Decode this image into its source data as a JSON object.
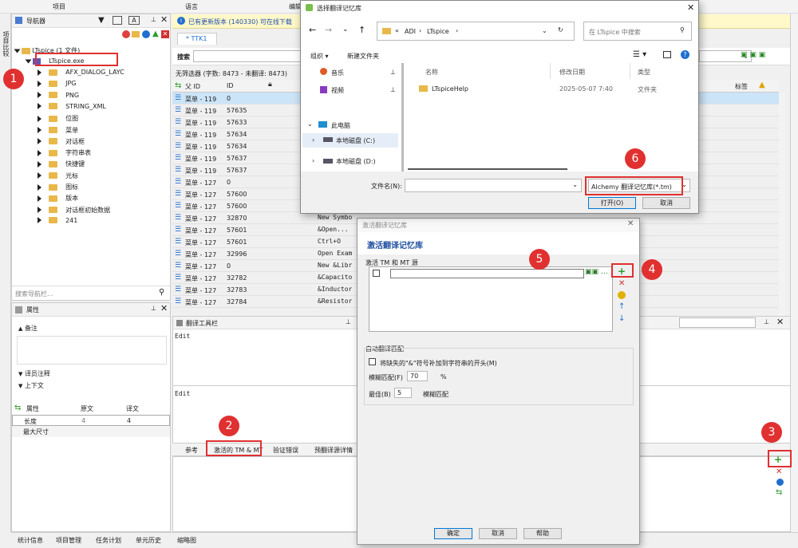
{
  "topbar": {
    "project": "项目",
    "lang": "语言",
    "edit": "编辑"
  },
  "left_vtab": "项目比较",
  "navigator": {
    "title": "导航器",
    "root": "LTspice (1 文件)",
    "file": "LTspice.exe",
    "items": [
      "AFX_DIALOG_LAYC",
      "JPG",
      "PNG",
      "STRING_XML",
      "位图",
      "菜单",
      "对话框",
      "字符串表",
      "快捷键",
      "光标",
      "图标",
      "版本",
      "对话框初始数据",
      "241"
    ],
    "search_placeholder": "搜索导航栏..."
  },
  "properties": {
    "title": "属性",
    "remarks": "备注",
    "translator_notes": "译员注释",
    "context": "上下文",
    "header": {
      "prop": "属性",
      "source": "原文",
      "target": "译文"
    },
    "rows": [
      {
        "name": "长度",
        "source": "4",
        "target": "4"
      },
      {
        "name": "最大尺寸",
        "source": "",
        "target": ""
      }
    ]
  },
  "infobar": {
    "text": "已有更新版本 (140330) 可在线下载"
  },
  "tab": {
    "label": "* TTK1"
  },
  "searchbar": {
    "label": "搜索"
  },
  "filter": {
    "text": "无筛选器 (字数: 8473 - 未翻译: 8473)"
  },
  "grid": {
    "headers": {
      "parent_id": "父 ID",
      "id": "ID",
      "tag": "标签"
    },
    "rows": [
      {
        "parent": "菜单 - 119",
        "id": "0",
        "text": ""
      },
      {
        "parent": "菜单 - 119",
        "id": "57635",
        "text": ""
      },
      {
        "parent": "菜单 - 119",
        "id": "57633",
        "text": ""
      },
      {
        "parent": "菜单 - 119",
        "id": "57634",
        "text": ""
      },
      {
        "parent": "菜单 - 119",
        "id": "57634",
        "text": ""
      },
      {
        "parent": "菜单 - 119",
        "id": "57637",
        "text": ""
      },
      {
        "parent": "菜单 - 119",
        "id": "57637",
        "text": ""
      },
      {
        "parent": "菜单 - 127",
        "id": "0",
        "text": ""
      },
      {
        "parent": "菜单 - 127",
        "id": "57600",
        "text": ""
      },
      {
        "parent": "菜单 - 127",
        "id": "57600",
        "text": ""
      },
      {
        "parent": "菜单 - 127",
        "id": "32870",
        "text": "New Symbo"
      },
      {
        "parent": "菜单 - 127",
        "id": "57601",
        "text": "&Open..."
      },
      {
        "parent": "菜单 - 127",
        "id": "57601",
        "text": "Ctrl+O"
      },
      {
        "parent": "菜单 - 127",
        "id": "32996",
        "text": "Open Exam"
      },
      {
        "parent": "菜单 - 127",
        "id": "0",
        "text": "New &Libr"
      },
      {
        "parent": "菜单 - 127",
        "id": "32782",
        "text": "&Capacito"
      },
      {
        "parent": "菜单 - 127",
        "id": "32783",
        "text": "&Inductor"
      },
      {
        "parent": "菜单 - 127",
        "id": "32784",
        "text": "&Resistor"
      }
    ]
  },
  "translation_toolbar": {
    "title": "翻译工具栏",
    "source": "Edit",
    "target": "Edit"
  },
  "bottom_tabs": [
    "参考",
    "激活的 TM & MT",
    "验证错误",
    "预翻译源详情"
  ],
  "status_tabs": [
    "统计信息",
    "项目管理",
    "任务计划",
    "单元历史",
    "缩略图"
  ],
  "file_dialog": {
    "title": "选择翻译记忆库",
    "path": [
      "ADI",
      "LTspice"
    ],
    "search_placeholder": "在 LTspice 中搜索",
    "organize": "组织",
    "new_folder": "新建文件夹",
    "nav": [
      "音乐",
      "视频",
      "此电脑",
      "本地磁盘 (C:)",
      "本地磁盘 (D:)"
    ],
    "columns": {
      "name": "名称",
      "date": "修改日期",
      "type": "类型"
    },
    "files": [
      {
        "name": "LTspiceHelp",
        "date": "2025-05-07 7:40",
        "type": "文件夹"
      }
    ],
    "filename_label": "文件名(N):",
    "filetype": "Alchemy 翻译记忆库(*.tm)",
    "open": "打开(O)",
    "cancel": "取消"
  },
  "tm_dialog": {
    "title": "激活翻译记忆库",
    "heading": "激活翻译记忆库",
    "sources_label": "激活 TM 和 MT 源",
    "auto_label": "自动翻译匹配",
    "append_label": "将缺失的\"&\"符号补加到字符串的开头(M)",
    "fuzzy_label": "模糊匹配(F)",
    "fuzzy_value": "70",
    "percent": "%",
    "best_label": "最佳(B)",
    "best_value": "5",
    "best_suffix": "模糊匹配",
    "ok": "确定",
    "cancel": "取消",
    "help": "帮助"
  },
  "annotations": [
    "1",
    "2",
    "3",
    "4",
    "5",
    "6"
  ],
  "colors": {
    "accent": "#0078d7",
    "annotation": "#e03030",
    "selected_row": "#cce4f7"
  }
}
